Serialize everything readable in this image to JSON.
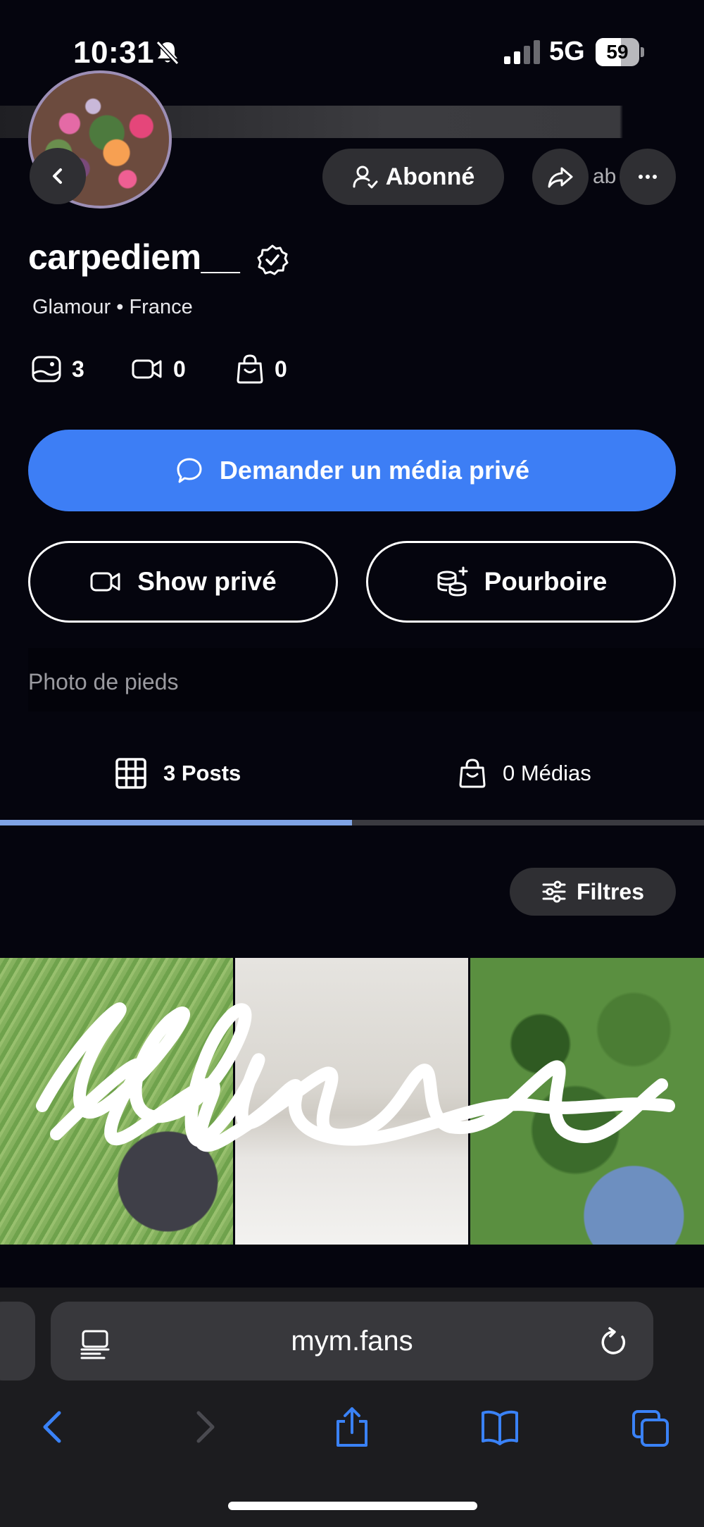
{
  "status_bar": {
    "time": "10:31",
    "network": "5G",
    "battery": "59",
    "battery_level_percent": 59
  },
  "header": {
    "subscribed_label": "Abonné",
    "share_label": "ab"
  },
  "profile": {
    "username": "carpediem__",
    "tagline": "Glamour • France",
    "stats": {
      "photos": "3",
      "videos": "0",
      "products": "0"
    },
    "bio": "Photo de pieds"
  },
  "actions": {
    "request_media": "Demander un média privé",
    "private_show": "Show privé",
    "tip": "Pourboire"
  },
  "tabs": {
    "posts": "3 Posts",
    "medias": "0 Médias",
    "active": "posts"
  },
  "filters_label": "Filtres",
  "browser": {
    "url": "mym.fans"
  },
  "colors": {
    "background": "#05050e",
    "accent": "#3d7ef5",
    "tab_indicator": "#7fa3e4",
    "chip": "#2f2f33",
    "ios_blue": "#3a82f7"
  }
}
